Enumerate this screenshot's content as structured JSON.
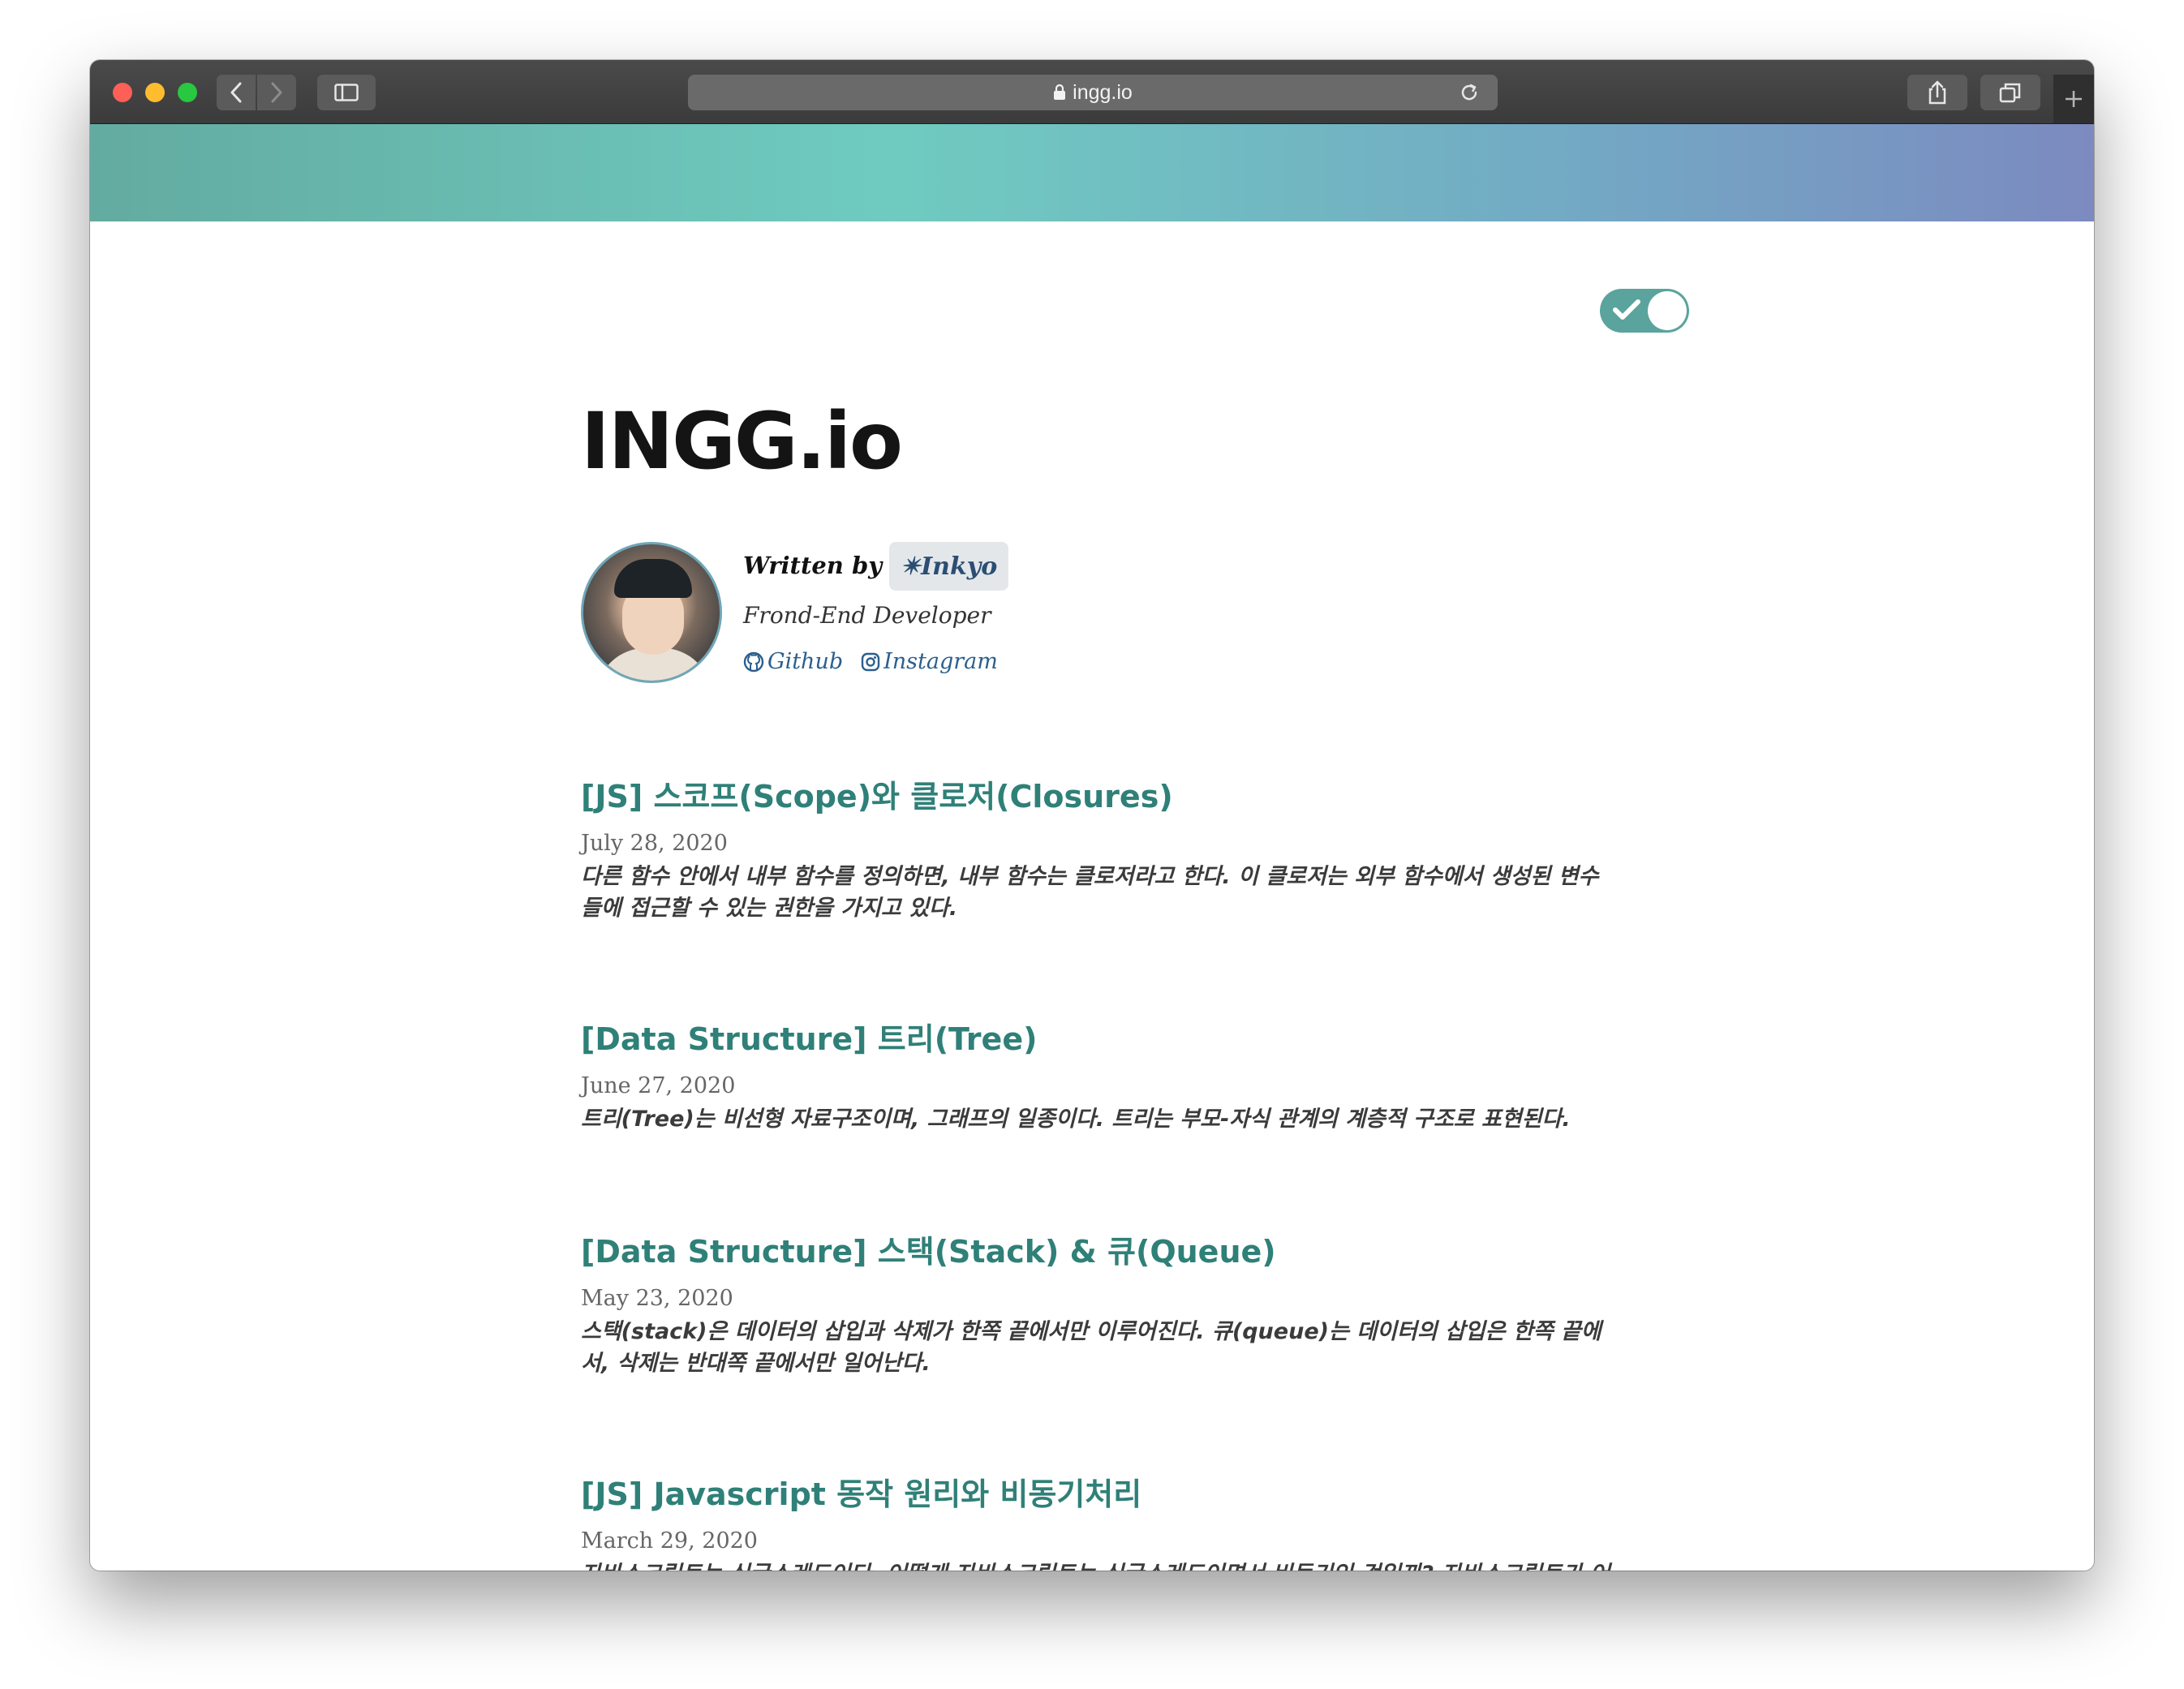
{
  "browser": {
    "url": "ingg.io"
  },
  "theme_toggle": {
    "checked": true
  },
  "site": {
    "title": "INGG.io"
  },
  "bio": {
    "written_by": "Written by",
    "author": "✴Inkyo",
    "role": "Frond-End Developer",
    "links": [
      {
        "label": "Github",
        "icon": "github-icon"
      },
      {
        "label": "Instagram",
        "icon": "instagram-icon"
      }
    ]
  },
  "posts": [
    {
      "title": "[JS] 스코프(Scope)와 클로저(Closures)",
      "date": "July 28, 2020",
      "excerpt": "다른 함수 안에서 내부 함수를 정의하면, 내부 함수는 클로저라고 한다. 이 클로저는 외부 함수에서 생성된 변수들에 접근할 수 있는 권한을 가지고 있다."
    },
    {
      "title": "[Data Structure] 트리(Tree)",
      "date": "June 27, 2020",
      "excerpt": "트리(Tree)는 비선형 자료구조이며, 그래프의 일종이다. 트리는 부모-자식 관계의 계층적 구조로 표현된다."
    },
    {
      "title": "[Data Structure] 스택(Stack) & 큐(Queue)",
      "date": "May 23, 2020",
      "excerpt": "스택(stack)은 데이터의 삽입과 삭제가 한쪽 끝에서만 이루어진다. 큐(queue)는 데이터의 삽입은 한쪽 끝에서, 삭제는 반대쪽 끝에서만 일어난다."
    },
    {
      "title": "[JS] Javascript 동작 원리와 비동기처리",
      "date": "March 29, 2020",
      "excerpt": "자바스크립트는 싱글스레드이다. 어떻게 자바스크립트는 싱글스레드이면서 비동기인 것일까? 자바스크립트가 어떻게 동작하는지 내부 원리에 대해 알아보자. 📌 Contents…"
    }
  ]
}
